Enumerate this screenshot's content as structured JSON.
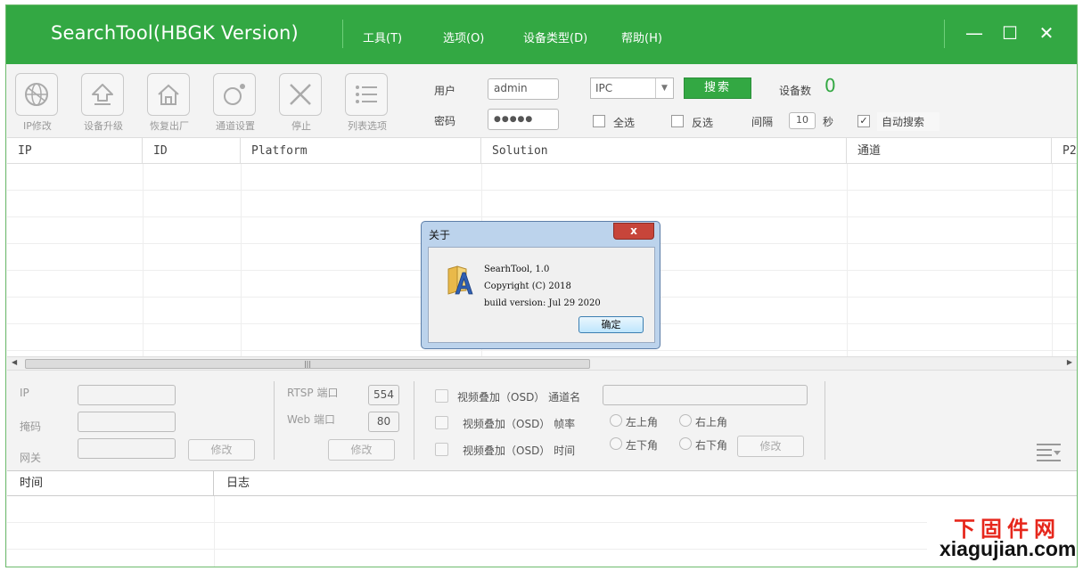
{
  "app": {
    "title": "SearchTool(HBGK Version)",
    "menu": [
      "工具(T)",
      "选项(O)",
      "设备类型(D)",
      "帮助(H)"
    ],
    "window_controls": {
      "minimize": "—",
      "maximize": "☐",
      "close": "✕"
    }
  },
  "toolbar": {
    "tools": [
      {
        "label": "IP修改",
        "icon": "globe-icon"
      },
      {
        "label": "设备升级",
        "icon": "upload-arrow-icon"
      },
      {
        "label": "恢复出厂",
        "icon": "home-icon"
      },
      {
        "label": "通道设置",
        "icon": "channel-settings-icon"
      },
      {
        "label": "停止",
        "icon": "stop-x-icon"
      },
      {
        "label": "列表选项",
        "icon": "list-icon"
      }
    ],
    "user_label": "用户",
    "user_value": "admin",
    "password_label": "密码",
    "password_value": "●●●●●",
    "device_type_value": "IPC",
    "search_button": "搜索",
    "device_count_label": "设备数",
    "device_count": "0",
    "select_all_label": "全选",
    "invert_label": "反选",
    "interval_label": "间隔",
    "interval_value": "10",
    "interval_unit": "秒",
    "auto_search_label": "自动搜索",
    "auto_search_checked": true
  },
  "grid": {
    "columns": [
      "IP",
      "ID",
      "Platform",
      "Solution",
      "通道",
      "P2"
    ]
  },
  "settings_panel": {
    "ip_label": "IP",
    "mask_label": "掩码",
    "gateway_label": "网关",
    "modify_button_1": "修改",
    "rtsp_port_label": "RTSP 端口",
    "rtsp_port_value": "554",
    "web_port_label": "Web 端口",
    "web_port_value": "80",
    "modify_button_2": "修改",
    "osd_name_label": "视频叠加（OSD） 通道名",
    "osd_rate_label": "视频叠加（OSD） 帧率",
    "osd_time_label": "视频叠加（OSD） 时间",
    "top_left": "左上角",
    "top_right": "右上角",
    "bottom_left": "左下角",
    "bottom_right": "右下角",
    "modify_button_3": "修改"
  },
  "log": {
    "columns": [
      "时间",
      "日志"
    ]
  },
  "about_dialog": {
    "title": "关于",
    "close": "x",
    "line1": "SearhTool, 1.0",
    "line2": "Copyright (C) 2018",
    "line3": "build version: Jul 29 2020",
    "ok_button": "确定"
  },
  "watermark": {
    "line1": "下固件网",
    "line2": "xiagujian.com"
  },
  "colors": {
    "accent": "#33a843",
    "count": "#33a843"
  }
}
